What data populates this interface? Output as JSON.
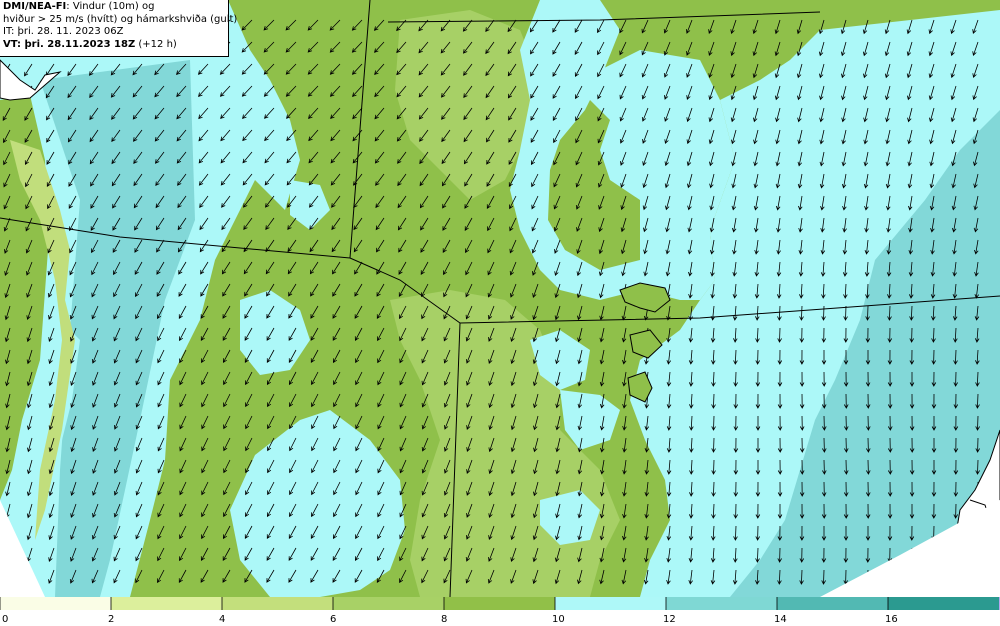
{
  "header": {
    "model": "DMI/NEA-FI",
    "title_rest": ": Vindur (10m) og",
    "line2": "hviður > 25 m/s (hvítt) og hámarkshviða (gult)",
    "line3": "IT: þri. 28. 11. 2023 06Z",
    "vt_label": "VT: þri. 28.11.2023 18Z",
    "vt_offset": " (+12 h)"
  },
  "legend": {
    "ticks": [
      "0",
      "2",
      "4",
      "6",
      "8",
      "10",
      "12",
      "14",
      "16"
    ],
    "colors": [
      "#fafde6",
      "#dcef9c",
      "#c3df7c",
      "#a8d166",
      "#91c048",
      "#aef8f8",
      "#7fd8d4",
      "#52b9b3",
      "#2b9a90",
      "#b8a6f0"
    ]
  },
  "map": {
    "wind_direction": "north-east",
    "colors": {
      "green_dark": "#8fc04a",
      "green_mid": "#a7d066",
      "green_light": "#c1de7c",
      "cyan": "#acf8f8",
      "teal": "#82d8d8",
      "line": "#000000"
    }
  }
}
